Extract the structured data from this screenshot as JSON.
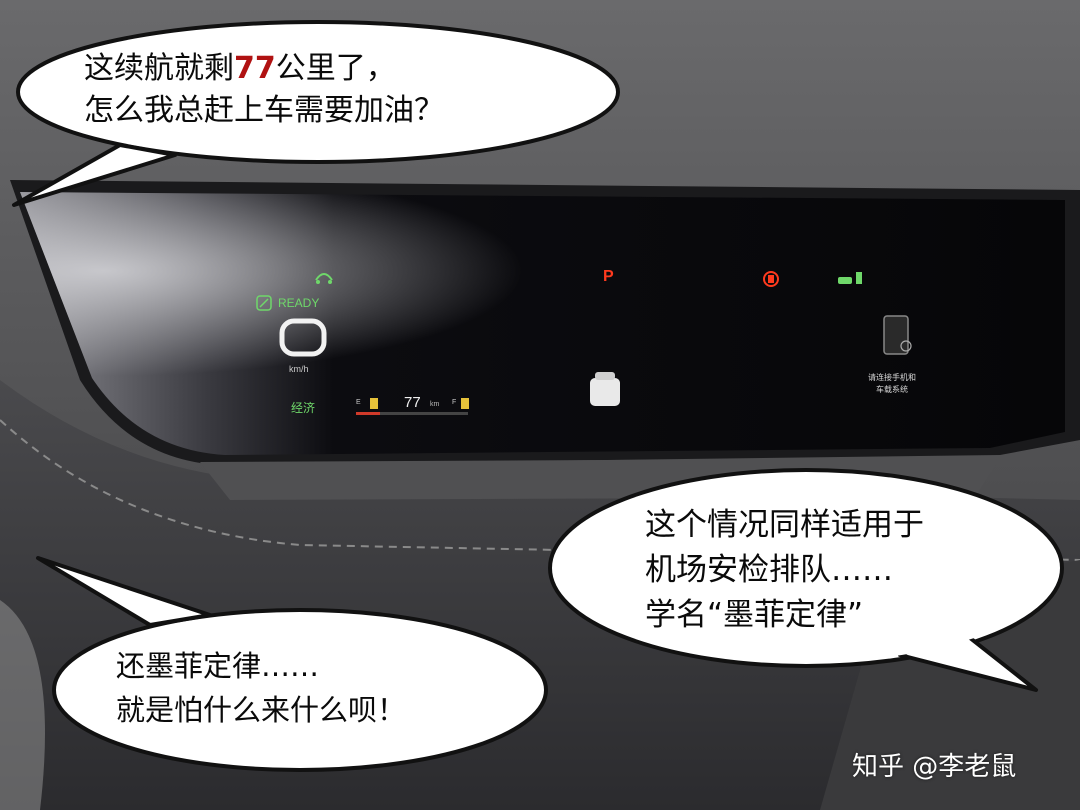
{
  "photo": {
    "subject": "car-dashboard-instrument-cluster",
    "colors": {
      "cluster_green": "#6fd86a",
      "gear_red": "#ff3a1e",
      "range_highlight": "#b01212"
    }
  },
  "cluster": {
    "ready_label": "READY",
    "speed_value": "0",
    "speed_unit": "km/h",
    "drive_mode": "经济",
    "fuel_empty_label": "E",
    "fuel_full_label": "F",
    "range_value": "77",
    "range_unit": "km",
    "gear": "P",
    "phone_message_line1": "请连接手机和",
    "phone_message_line2": "车载系统"
  },
  "bubbles": {
    "top_left": {
      "line1_before": "这续航就剩",
      "line1_highlight": "77",
      "line1_after": "公里了，",
      "line2": "怎么我总赶上车需要加油？"
    },
    "right": {
      "line1": "这个情况同样适用于",
      "line2": "机场安检排队……",
      "line3": "学名“墨菲定律”"
    },
    "bottom_left": {
      "line1": "还墨菲定律……",
      "line2": "就是怕什么来什么呗！"
    }
  },
  "watermark": "知乎 @李老鼠"
}
